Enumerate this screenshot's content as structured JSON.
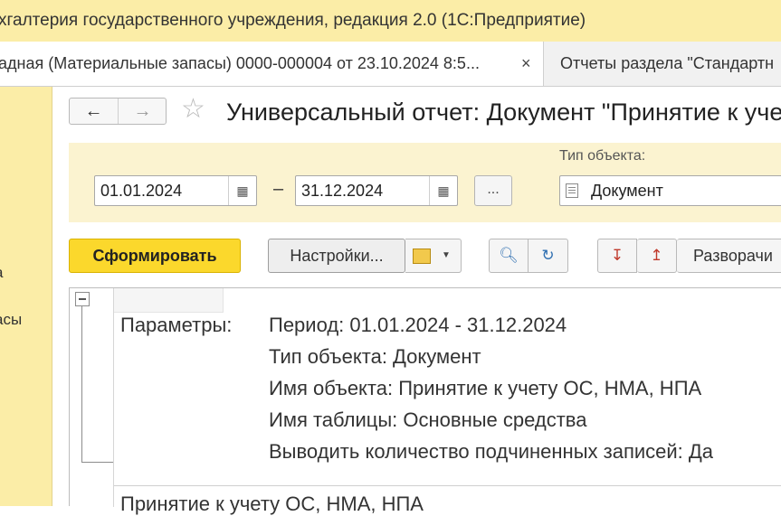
{
  "window": {
    "title": "хгалтерия государственного учреждения, редакция 2.0  (1С:Предприятие)"
  },
  "tabs": [
    {
      "label": "адная (Материальные запасы) 0000-000004 от 23.10.2024 8:5...",
      "close": "×"
    },
    {
      "label": "Отчеты раздела \"Стандартн"
    }
  ],
  "sidebar": {
    "items": [
      {
        "label": "а"
      },
      {
        "label": "асы"
      }
    ]
  },
  "toolbar": {
    "back": "←",
    "forward": "→",
    "favorite": "☆",
    "title": "Универсальный отчет: Документ \"Принятие к уче"
  },
  "filters": {
    "date_from": "01.01.2024",
    "date_to": "31.12.2024",
    "dash": "–",
    "more": "...",
    "object_type_label": "Тип объекта:",
    "object_type_value": "Документ"
  },
  "actions": {
    "generate": "Сформировать",
    "settings": "Настройки...",
    "expand": "Разворачи"
  },
  "report": {
    "params_label": "Параметры:",
    "params": [
      "Период: 01.01.2024 - 31.12.2024",
      "Тип объекта: Документ",
      "Имя объекта: Принятие к учету ОС, НМА, НПА",
      "Имя таблицы: Основные средства",
      "Выводить количество подчиненных записей: Да"
    ],
    "title": "Принятие к учету ОС, НМА, НПА"
  },
  "colors": {
    "accent_yellow": "#fbd82c",
    "panel_yellow": "#fbeda7",
    "filter_bg": "#fbf3d0"
  }
}
